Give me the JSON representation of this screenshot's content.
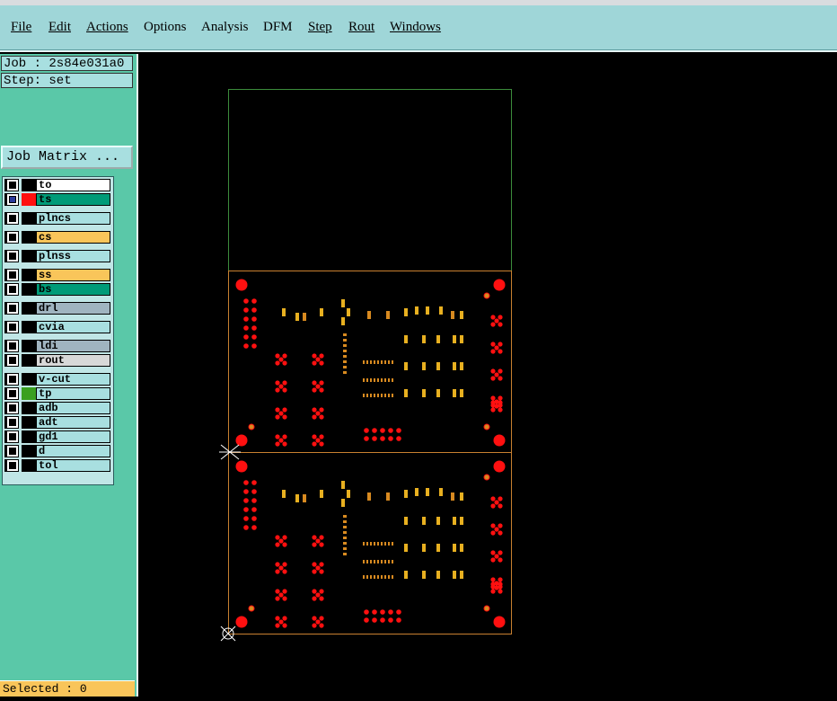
{
  "menu": [
    "File",
    "Edit",
    "Actions",
    "Options",
    "Analysis",
    "DFM",
    "Step",
    "Rout",
    "Windows"
  ],
  "job": {
    "label": "Job : 2s84e031a0",
    "step": "Step: set",
    "matrix_button": "Job Matrix ..."
  },
  "layers": [
    {
      "name": "to",
      "color": "#ffffff",
      "selected": false,
      "swatch": "#000000"
    },
    {
      "name": "ts",
      "color": "#009b78",
      "selected": true,
      "swatch": "#ff1010"
    },
    {
      "name": "plncs",
      "color": "#a8dfe0",
      "selected": false,
      "swatch": "#000000"
    },
    {
      "name": "cs",
      "color": "#f9c55a",
      "selected": false,
      "swatch": "#000000"
    },
    {
      "name": "plnss",
      "color": "#a8dfe0",
      "selected": false,
      "swatch": "#000000"
    },
    {
      "name": "ss",
      "color": "#f9c55a",
      "selected": false,
      "swatch": "#000000"
    },
    {
      "name": "bs",
      "color": "#009b78",
      "selected": false,
      "swatch": "#000000"
    },
    {
      "name": "drl",
      "color": "#a0b4c0",
      "selected": false,
      "swatch": "#000000"
    },
    {
      "name": "cvia",
      "color": "#a8dfe0",
      "selected": false,
      "swatch": "#000000"
    },
    {
      "name": "ldi",
      "color": "#a0b4c0",
      "selected": false,
      "swatch": "#000000"
    },
    {
      "name": "rout",
      "color": "#d8d8d8",
      "selected": false,
      "swatch": "#000000"
    },
    {
      "name": "v-cut",
      "color": "#a8dfe0",
      "selected": false,
      "swatch": "#000000"
    },
    {
      "name": "tp",
      "color": "#a8dfe0",
      "selected": false,
      "swatch": "#3aa020"
    },
    {
      "name": "adb",
      "color": "#a8dfe0",
      "selected": false,
      "swatch": "#000000"
    },
    {
      "name": "adt",
      "color": "#a8dfe0",
      "selected": false,
      "swatch": "#000000"
    },
    {
      "name": "gd1",
      "color": "#a8dfe0",
      "selected": false,
      "swatch": "#000000"
    },
    {
      "name": "d",
      "color": "#a8dfe0",
      "selected": false,
      "swatch": "#000000"
    },
    {
      "name": "tol",
      "color": "#a8dfe0",
      "selected": false,
      "swatch": "#000000"
    }
  ],
  "status": {
    "selected": "Selected : 0"
  },
  "colors": {
    "pad_red": "#ff1010",
    "pad_orange": "#d88a20",
    "pad_yellow": "#e8b020",
    "outline_green": "#3c8c3c",
    "outline_orange": "#c88030",
    "menubar": "#9fd6d8",
    "panel": "#5ac8a8"
  }
}
